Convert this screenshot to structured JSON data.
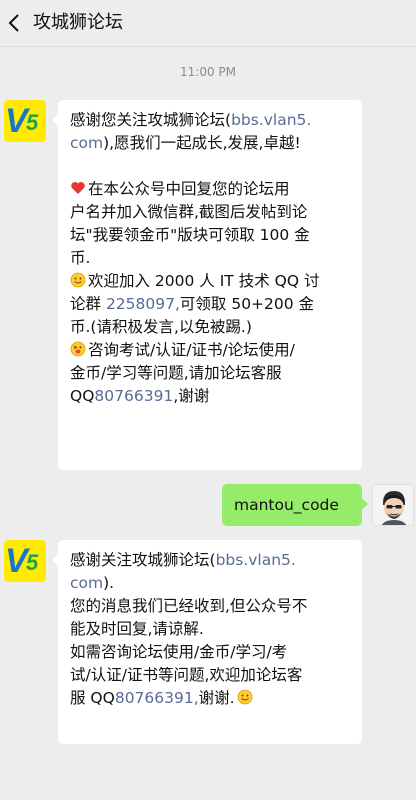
{
  "header": {
    "title": "攻城狮论坛"
  },
  "timestamp": "11:00 PM",
  "messages": {
    "m1": {
      "l1": "感谢您关注攻城狮论坛(",
      "l1_link": "bbs.vlan5.",
      "l2_link": "com",
      "l2_rest": "),愿我们一起成长,发展,卓越!",
      "l3": "在本公众号中回复您的论坛用",
      "l4": "户名并加入微信群,截图后发帖到论",
      "l5": "坛\"我要领金币\"版块可领取 100 金",
      "l6": "币.",
      "l7": "欢迎加入 2000 人 IT 技术 QQ 讨",
      "l8a": "论群 ",
      "l8_link": "2258097,",
      "l8b": "可领取 50+200 金",
      "l9": "币.(请积极发言,以免被踢.)",
      "l10": "咨询考试/认证/证书/论坛使用/",
      "l11": "金币/学习等问题,请加论坛客服",
      "l12a": "QQ",
      "l12_link": "80766391",
      "l12b": ",谢谢"
    },
    "user": {
      "text": "mantou_code"
    },
    "m2": {
      "l1": "感谢关注攻城狮论坛(",
      "l1_link": "bbs.vlan5.",
      "l2_link": "com",
      "l2_rest": ").",
      "l3": "您的消息我们已经收到,但公众号不",
      "l4": "能及时回复,请谅解.",
      "l5": "如需咨询论坛使用/金币/学习/考",
      "l6": "试/认证/证书等问题,欢迎加论坛客",
      "l7a": "服 QQ",
      "l7_link": "80766391,",
      "l7b": "谢谢."
    }
  },
  "avatars": {
    "bot_letter": "V",
    "bot_number": "5"
  },
  "colors": {
    "link": "#576b95",
    "user_bubble": "#95ec69",
    "logo_bg": "#ffea00"
  },
  "icons": [
    "back-chevron-icon",
    "heart-icon",
    "smile-icon",
    "tongue-out-icon",
    "smile-icon"
  ]
}
